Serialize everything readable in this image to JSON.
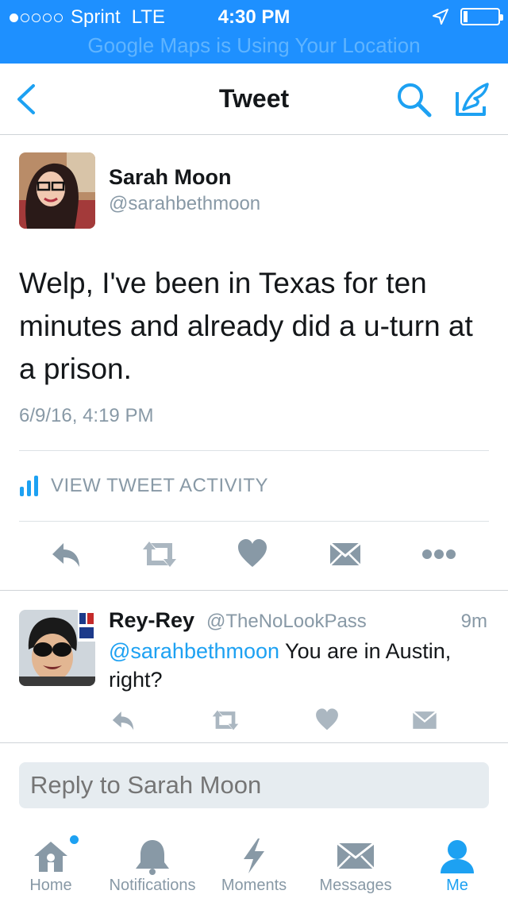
{
  "status_bar": {
    "signal_bars_filled": 1,
    "signal_bars_total": 5,
    "carrier": "Sprint",
    "network": "LTE",
    "time": "4:30 PM",
    "battery_level": 0.1,
    "location_banner": "Google Maps is Using Your Location"
  },
  "nav": {
    "title": "Tweet",
    "back_icon": "chevron-left-icon",
    "search_icon": "search-icon",
    "compose_icon": "compose-tweet-icon"
  },
  "tweet": {
    "author_name": "Sarah Moon",
    "author_handle": "@sarahbethmoon",
    "text": "Welp, I've been in Texas for ten minutes and already did a u-turn at a prison.",
    "timestamp": "6/9/16, 4:19 PM",
    "activity_label": "VIEW TWEET ACTIVITY"
  },
  "reply": {
    "author_name": "Rey-Rey",
    "author_handle": "@TheNoLookPass",
    "age": "9m",
    "mention": "@sarahbethmoon",
    "text": " You are in Austin, right?"
  },
  "reply_box": {
    "placeholder": "Reply to Sarah Moon"
  },
  "tabs": [
    {
      "label": "Home",
      "icon": "home-icon",
      "active": false
    },
    {
      "label": "Notifications",
      "icon": "bell-icon",
      "active": false
    },
    {
      "label": "Moments",
      "icon": "lightning-icon",
      "active": false
    },
    {
      "label": "Messages",
      "icon": "envelope-icon",
      "active": false
    },
    {
      "label": "Me",
      "icon": "person-icon",
      "active": true
    }
  ],
  "colors": {
    "status_bar": "#1e90ff",
    "accent": "#1da1f2",
    "secondary_text": "#8899a6",
    "action_icon": "#8899a6"
  }
}
